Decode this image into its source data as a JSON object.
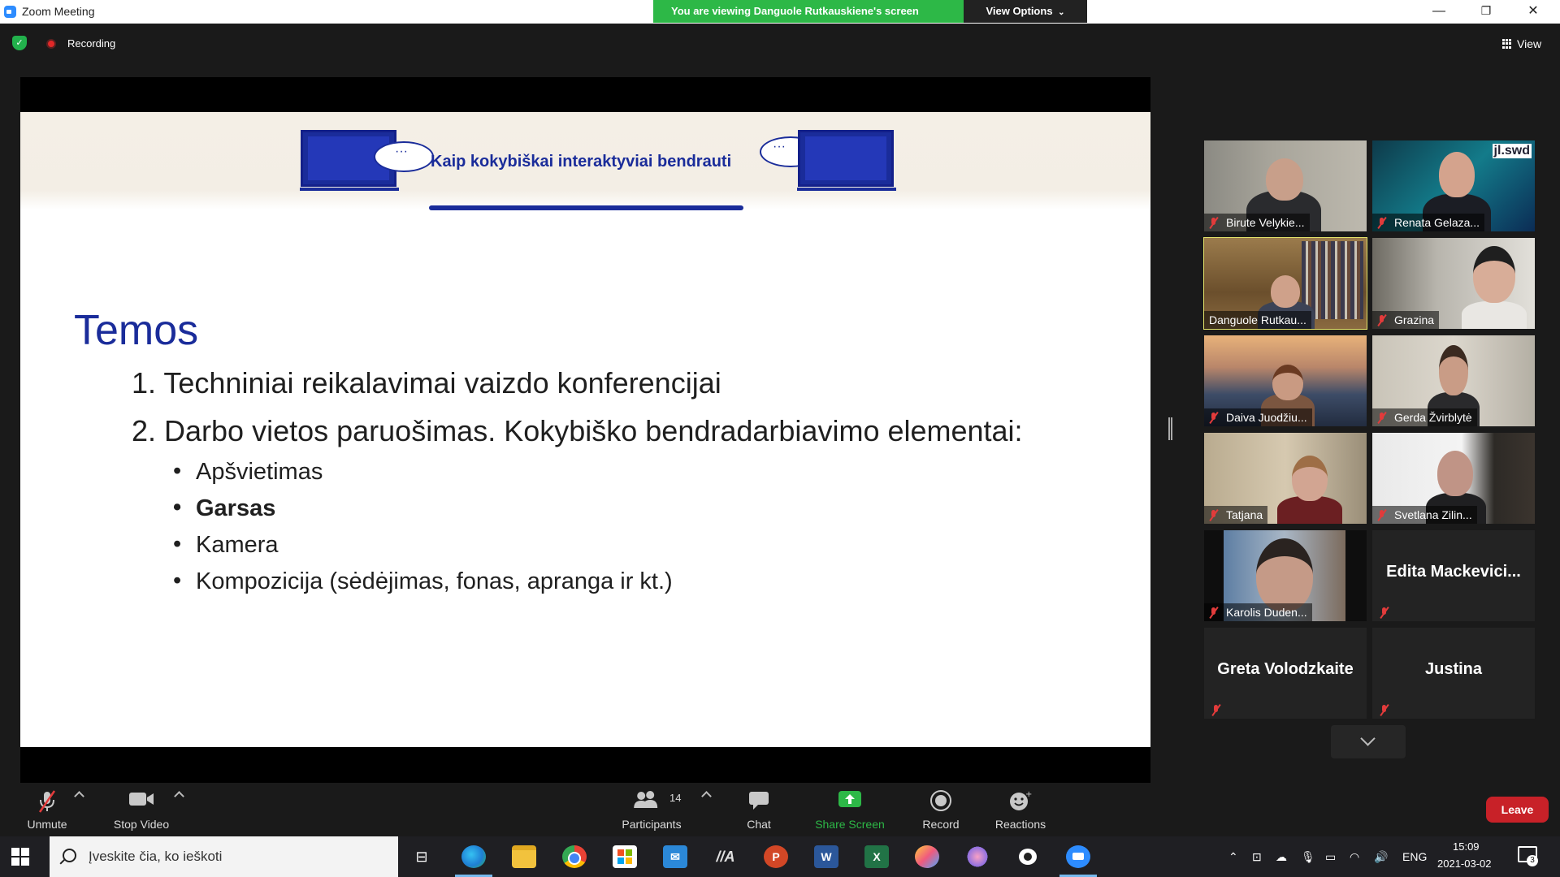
{
  "window": {
    "title": "Zoom Meeting",
    "viewing_banner": "You are viewing Danguole Rutkauskiene's screen",
    "view_options": "View Options",
    "minimize": "—",
    "restore": "❐",
    "close": "✕"
  },
  "topbar": {
    "recording_label": "Recording",
    "view_label": "View"
  },
  "slide": {
    "header_title": "Kaip kokybiškai interaktyviai bendrauti",
    "heading": "Temos",
    "items": [
      "1. Techniniai reikalavimai vaizdo konferencijai",
      "2. Darbo vietos paruošimas. Kokybiško bendradarbiavimo elementai:"
    ],
    "bullets": [
      {
        "text": "Apšvietimas",
        "bold": false
      },
      {
        "text": "Garsas",
        "bold": true
      },
      {
        "text": "Kamera",
        "bold": false
      },
      {
        "text": "Kompozicija (sėdėjimas, fonas, apranga ir kt.)",
        "bold": false
      }
    ]
  },
  "participants": [
    {
      "name": "Birute Velykie...",
      "video": true,
      "speaking": false
    },
    {
      "name": "Renata Gelaza...",
      "video": true,
      "speaking": false,
      "watermark": "jl.swd"
    },
    {
      "name": "Danguole Rutkau...",
      "video": true,
      "speaking": true
    },
    {
      "name": "Grazina",
      "video": true,
      "speaking": false
    },
    {
      "name": "Daiva Juodžiu...",
      "video": true,
      "speaking": false
    },
    {
      "name": "Gerda Žvirblytė",
      "video": true,
      "speaking": false
    },
    {
      "name": "Tatjana",
      "video": true,
      "speaking": false
    },
    {
      "name": "Svetlana Zilin...",
      "video": true,
      "speaking": false
    },
    {
      "name": "Karolis Duden...",
      "video": true,
      "speaking": false
    },
    {
      "name": "Edita  Mackevici...",
      "video": false,
      "speaking": false
    },
    {
      "name": "Greta Volodzkaite",
      "video": false,
      "speaking": false
    },
    {
      "name": "Justina",
      "video": false,
      "speaking": false
    }
  ],
  "toolbar": {
    "unmute": "Unmute",
    "stop_video": "Stop Video",
    "participants": "Participants",
    "participants_count": "14",
    "chat": "Chat",
    "share_screen": "Share Screen",
    "record": "Record",
    "reactions": "Reactions",
    "leave": "Leave"
  },
  "taskbar": {
    "search_placeholder": "Įveskite čia, ko ieškoti",
    "language": "ENG",
    "time": "15:09",
    "date": "2021-03-02",
    "notifications": "3",
    "apps": [
      "task-view",
      "edge",
      "file-explorer",
      "chrome",
      "store",
      "mail",
      "app-a",
      "powerpoint",
      "word",
      "excel",
      "paint",
      "snip",
      "obs",
      "zoom"
    ]
  },
  "colors": {
    "zoom_blue": "#2d8cff",
    "banner_green": "#2db847",
    "leave_red": "#c82128",
    "slide_blue": "#1a2c9a",
    "speaker_outline": "#e3e36a"
  }
}
